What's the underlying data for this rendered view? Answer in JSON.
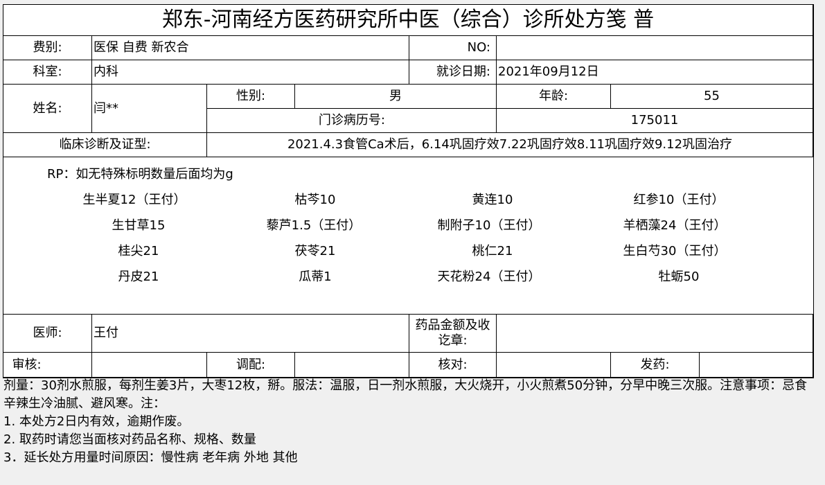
{
  "form": {
    "title": "郑东-河南经方医药研究所中医（综合）诊所处方笺 普",
    "fee_label": "费别:",
    "fee_value": "医保 自费 新农合",
    "no_label": "NO:",
    "no_value": "",
    "dept_label": "科室:",
    "dept_value": "内科",
    "visit_date_label": "就诊日期:",
    "visit_date_value": "2021年09月12日",
    "name_label": "姓名:",
    "name_value": "闫**",
    "sex_label": "性别:",
    "sex_value": "男",
    "age_label": "年龄:",
    "age_value": "55",
    "record_label": "门诊病历号:",
    "record_value": "175011",
    "diagnosis_label": "临床诊断及证型:",
    "diagnosis_value": "2021.4.3食管Ca术后，6.14巩固疗效7.22巩固疗效8.11巩固疗效9.12巩固治疗"
  },
  "prescription": {
    "rp_note": "RP：如无特殊标明数量后面均为g",
    "herbs": [
      [
        "生半夏12（王付）",
        "枯芩10",
        "黄连10",
        "红参10（王付）"
      ],
      [
        "生甘草15",
        "藜芦1.5（王付）",
        "制附子10（王付）",
        "羊栖藻24（王付）"
      ],
      [
        "桂尖21",
        "茯苓21",
        "桃仁21",
        "生白芍30（王付）"
      ],
      [
        "丹皮21",
        "瓜蒂1",
        "天花粉24（王付）",
        "牡蛎50"
      ]
    ]
  },
  "footer": {
    "doctor_label": "医师:",
    "doctor_value": "王付",
    "amount_label": "药品金额及收讫章:",
    "amount_value": "",
    "review_label": "审核:",
    "review_value": "",
    "dispense_label": "调配:",
    "dispense_value": "",
    "check_label": "核对:",
    "check_value": "",
    "issue_label": "发药:",
    "issue_value": ""
  },
  "notes": {
    "line1": "剂量：30剂水煎服，每剂生姜3片，大枣12枚，掰。服法：温服，日一剂水煎服，大火烧开，小火煎煮50分钟，分早中晚三次服。注意事项：忌食辛辣生冷油腻、避风寒。注：",
    "line2": "1. 本处方2日内有效，逾期作废。",
    "line3": "2. 取药时请您当面核对药品名称、规格、数量",
    "line4": "3．延长处方用量时间原因：慢性病 老年病 外地 其他"
  }
}
